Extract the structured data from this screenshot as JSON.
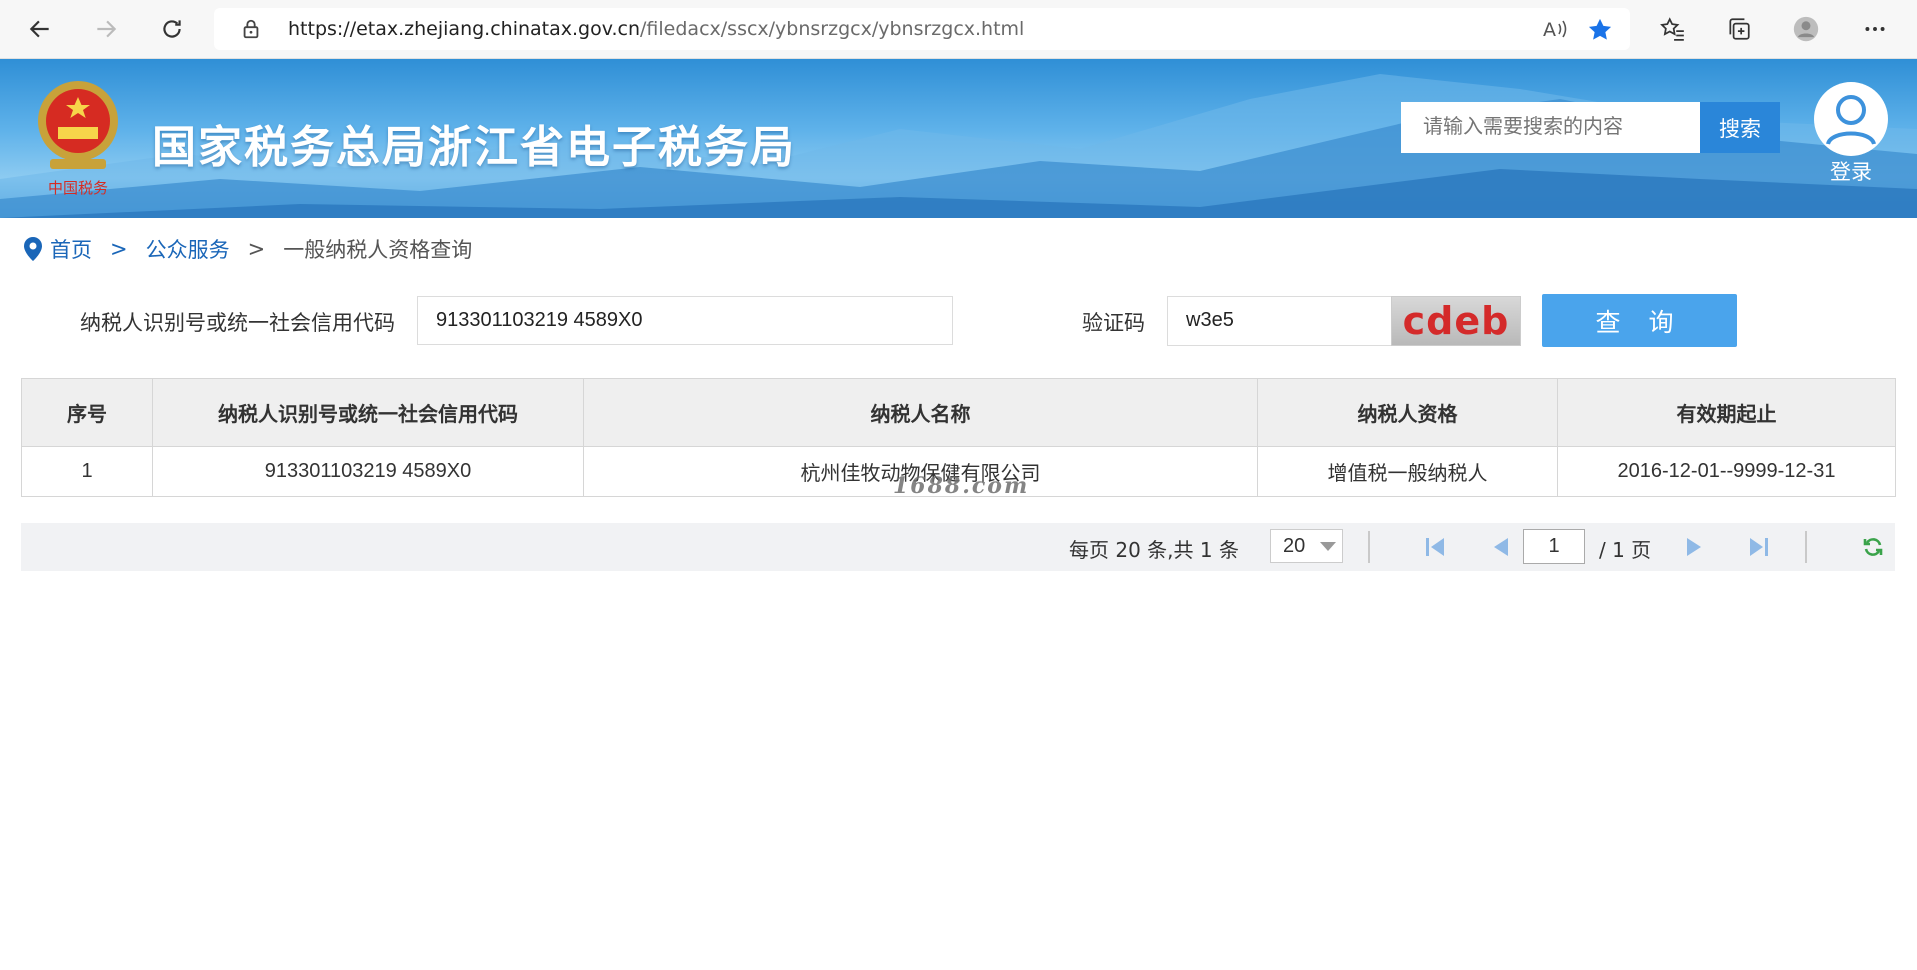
{
  "browser": {
    "url_host": "https://etax.zhejiang.chinatax.gov.cn",
    "url_path": "/filedacx/sscx/ybnsrzgcx/ybnsrzgcx.html"
  },
  "header": {
    "emblem_caption": "中国税务",
    "site_title": "国家税务总局浙江省电子税务局",
    "search_placeholder": "请输入需要搜索的内容",
    "search_button": "搜索",
    "login_label": "登录"
  },
  "breadcrumb": {
    "home": "首页",
    "section": "公众服务",
    "separator": ">",
    "current": "一般纳税人资格查询"
  },
  "query_form": {
    "taxpayer_id_label": "纳税人识别号或统一社会信用代码",
    "taxpayer_id_value": "913301103219 4589X0",
    "captcha_label": "验证码",
    "captcha_value": "w3e5",
    "captcha_image_text": "cdeb",
    "query_button": "查 询"
  },
  "results_table": {
    "columns": [
      "序号",
      "纳税人识别号或统一社会信用代码",
      "纳税人名称",
      "纳税人资格",
      "有效期起止"
    ],
    "rows": [
      [
        "1",
        "913301103219 4589X0",
        "杭州佳牧动物保健有限公司",
        "增值税一般纳税人",
        "2016-12-01--9999-12-31"
      ]
    ]
  },
  "watermark": "1688.com",
  "pager": {
    "info": "每页 20 条,共 1 条",
    "page_size": "20",
    "current_page": "1",
    "total_pages": "/ 1 页"
  },
  "colors": {
    "accent_blue": "#4aa4ec",
    "search_button": "#2a86d9",
    "link_blue": "#1a66b8",
    "star_blue": "#1a73e8",
    "refresh_green": "#3aa34a"
  }
}
